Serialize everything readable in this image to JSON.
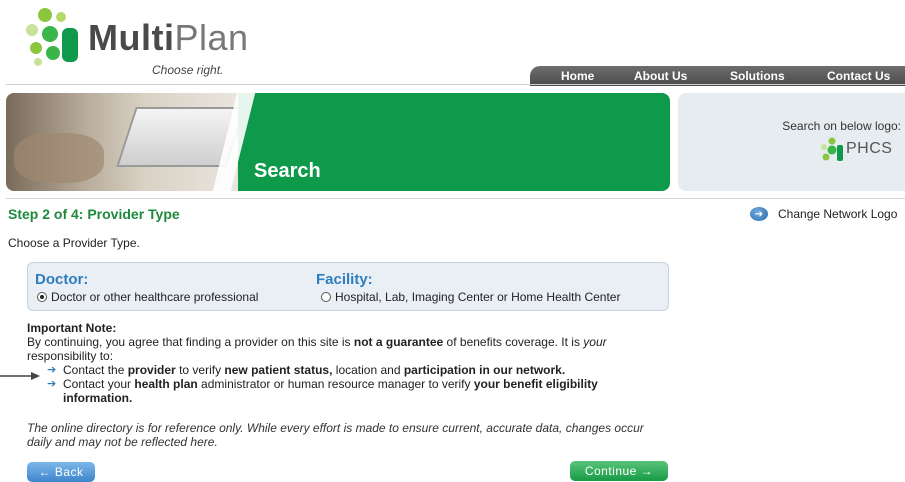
{
  "brand": {
    "name_bold": "Multi",
    "name_light": "Plan",
    "tagline": "Choose right.",
    "colors": {
      "green": "#0f9a4b",
      "blue": "#2d7ec0",
      "nav": "#5a5a5a"
    }
  },
  "nav": {
    "items": [
      {
        "label": "Home"
      },
      {
        "label": "About Us"
      },
      {
        "label": "Solutions"
      },
      {
        "label": "Contact Us"
      }
    ]
  },
  "banner": {
    "title": "Search",
    "side_label": "Search on below logo:",
    "network_logo_text": "PHCS"
  },
  "step": {
    "title": "Step 2 of 4: Provider Type",
    "change_network_label": "Change Network Logo",
    "instruction": "Choose a Provider Type."
  },
  "provider_types": {
    "doctor": {
      "heading": "Doctor:",
      "option_label": "Doctor or other healthcare professional",
      "selected": true
    },
    "facility": {
      "heading": "Facility:",
      "option_label": "Hospital, Lab, Imaging Center or Home Health Center",
      "selected": false
    }
  },
  "note": {
    "heading": "Important Note:",
    "p1_a": "By continuing, you agree that finding a provider on this site is ",
    "p1_b": "not a guarantee",
    "p1_c": " of benefits coverage. It is ",
    "p1_d": "your",
    "p1_e": " responsibility to:",
    "b1_a": "Contact the ",
    "b1_b": "provider",
    "b1_c": " to verify ",
    "b1_d": "new patient status,",
    "b1_e": " location and ",
    "b1_f": "participation in our network.",
    "b2_a": "Contact your ",
    "b2_b": "health plan",
    "b2_c": " administrator or human resource manager to verify ",
    "b2_d": "your benefit eligibility information."
  },
  "disclaimer": "The online directory is for reference only. While every effort is made to ensure current, accurate data, changes occur daily and may not be reflected here.",
  "buttons": {
    "back": "← Back",
    "continue": "Continue →"
  }
}
